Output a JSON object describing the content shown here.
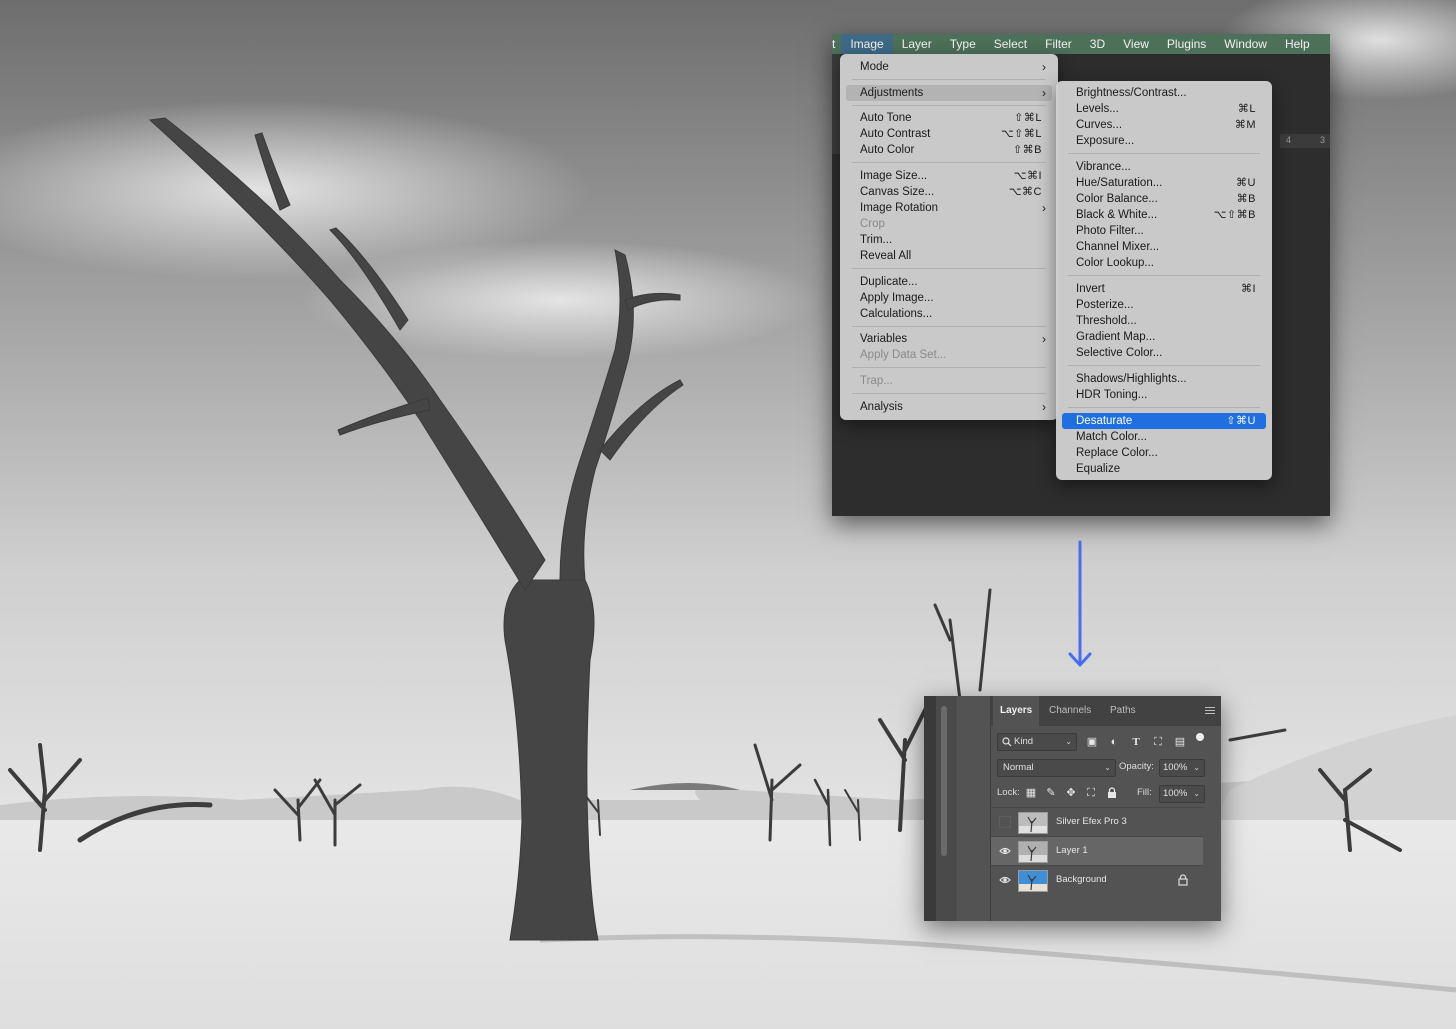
{
  "menubar": {
    "items": [
      "t",
      "Image",
      "Layer",
      "Type",
      "Select",
      "Filter",
      "3D",
      "View",
      "Plugins",
      "Window",
      "Help"
    ],
    "active": "Image"
  },
  "image_menu": {
    "items": [
      {
        "label": "Mode",
        "submenu": true
      },
      {
        "label": "Adjustments",
        "submenu": true,
        "highlighted": true
      },
      {
        "label": "Auto Tone",
        "shortcut": "⇧⌘L"
      },
      {
        "label": "Auto Contrast",
        "shortcut": "⌥⇧⌘L"
      },
      {
        "label": "Auto Color",
        "shortcut": "⇧⌘B"
      },
      {
        "label": "Image Size...",
        "shortcut": "⌥⌘I"
      },
      {
        "label": "Canvas Size...",
        "shortcut": "⌥⌘C"
      },
      {
        "label": "Image Rotation",
        "submenu": true
      },
      {
        "label": "Crop",
        "disabled": true
      },
      {
        "label": "Trim..."
      },
      {
        "label": "Reveal All"
      },
      {
        "label": "Duplicate..."
      },
      {
        "label": "Apply Image..."
      },
      {
        "label": "Calculations..."
      },
      {
        "label": "Variables",
        "submenu": true
      },
      {
        "label": "Apply Data Set...",
        "disabled": true
      },
      {
        "label": "Trap...",
        "disabled": true
      },
      {
        "label": "Analysis",
        "submenu": true
      }
    ]
  },
  "adjustments_menu": {
    "items": [
      {
        "label": "Brightness/Contrast..."
      },
      {
        "label": "Levels...",
        "shortcut": "⌘L"
      },
      {
        "label": "Curves...",
        "shortcut": "⌘M"
      },
      {
        "label": "Exposure..."
      },
      {
        "label": "Vibrance..."
      },
      {
        "label": "Hue/Saturation...",
        "shortcut": "⌘U"
      },
      {
        "label": "Color Balance...",
        "shortcut": "⌘B"
      },
      {
        "label": "Black & White...",
        "shortcut": "⌥⇧⌘B"
      },
      {
        "label": "Photo Filter..."
      },
      {
        "label": "Channel Mixer..."
      },
      {
        "label": "Color Lookup..."
      },
      {
        "label": "Invert",
        "shortcut": "⌘I"
      },
      {
        "label": "Posterize..."
      },
      {
        "label": "Threshold..."
      },
      {
        "label": "Gradient Map..."
      },
      {
        "label": "Selective Color..."
      },
      {
        "label": "Shadows/Highlights..."
      },
      {
        "label": "HDR Toning..."
      },
      {
        "label": "Desaturate",
        "shortcut": "⇧⌘U",
        "selected": true
      },
      {
        "label": "Match Color..."
      },
      {
        "label": "Replace Color..."
      },
      {
        "label": "Equalize"
      }
    ]
  },
  "ruler": {
    "marks": [
      "4",
      "3"
    ]
  },
  "layers_panel": {
    "tabs": [
      "Layers",
      "Channels",
      "Paths"
    ],
    "active_tab": "Layers",
    "filter": {
      "label": "Kind"
    },
    "blend_mode": "Normal",
    "opacity_label": "Opacity:",
    "opacity": "100%",
    "lock_label": "Lock:",
    "fill_label": "Fill:",
    "fill": "100%",
    "layers": [
      {
        "name": "Silver Efex Pro 3",
        "visible": false,
        "selected": false,
        "locked": false
      },
      {
        "name": "Layer 1",
        "visible": true,
        "selected": true,
        "locked": false
      },
      {
        "name": "Background",
        "visible": true,
        "selected": false,
        "locked": true
      }
    ]
  },
  "colors": {
    "menubar": "#4d7058",
    "highlight": "#1f6fe0",
    "arrow": "#4a6cf0"
  }
}
